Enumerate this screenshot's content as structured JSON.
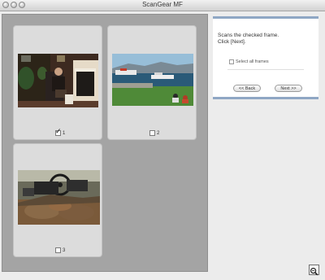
{
  "window": {
    "title": "ScanGear MF"
  },
  "frames": [
    {
      "number": "1",
      "checked": true
    },
    {
      "number": "2",
      "checked": false
    },
    {
      "number": "3",
      "checked": false
    }
  ],
  "instructions": {
    "line1": "Scans the checked frame.",
    "line2": "Click [Next]."
  },
  "select_all": {
    "label": "Select all frames",
    "checked": false
  },
  "buttons": {
    "back": "<< Back",
    "next": "Next >>"
  },
  "icons": {
    "zoom": "magnifier-zoom-icon",
    "frame_checkbox": "checkbox-icon"
  }
}
